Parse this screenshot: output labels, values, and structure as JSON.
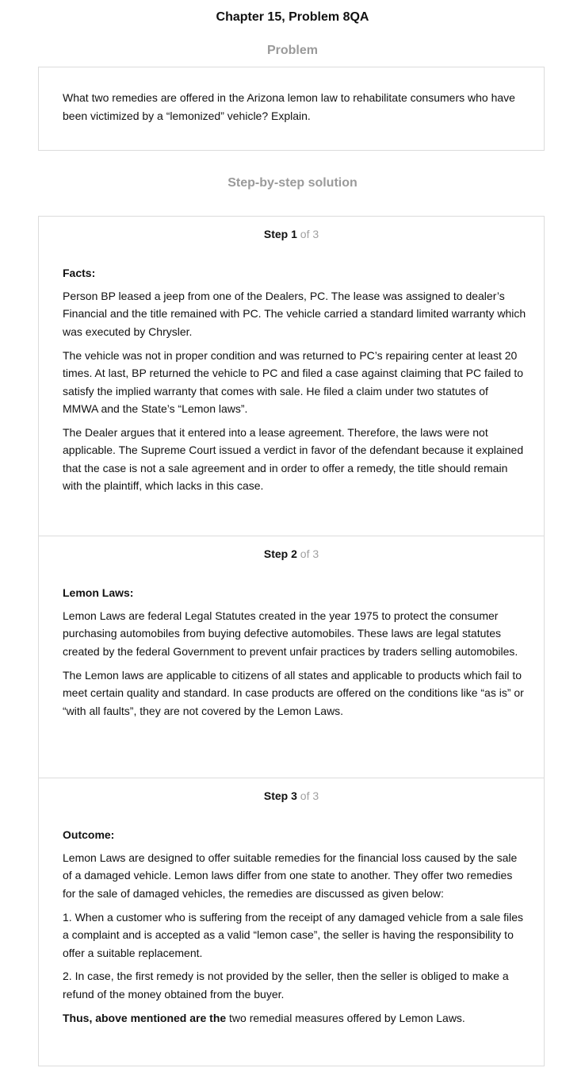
{
  "title": "Chapter 15, Problem 8QA",
  "problem": {
    "heading": "Problem",
    "text": "What two remedies are offered in the Arizona lemon law to rehabilitate consumers who have been victimized by a “lemonized” vehicle? Explain."
  },
  "solution": {
    "heading": "Step-by-step solution",
    "steps": [
      {
        "label": "Step",
        "number": "1",
        "of": "of 3",
        "heading": "Facts:",
        "paragraphs": [
          "Person BP leased a jeep from one of the Dealers, PC. The lease was assigned to dealer’s Financial and the title remained with PC. The vehicle carried a standard limited warranty which was executed by Chrysler.",
          "The vehicle was not in proper condition and was returned to PC’s repairing center at least 20 times. At last, BP returned the vehicle to PC and filed a case against claiming that PC failed to satisfy the implied warranty that comes with sale. He filed a claim under two statutes of MMWA and the State’s “Lemon laws”.",
          "The Dealer argues that it entered into a lease agreement. Therefore, the laws were not applicable. The Supreme Court issued a verdict in favor of the defendant because it explained that the case is not a sale agreement and in order to offer a remedy, the title should remain with the plaintiff, which lacks in this case."
        ]
      },
      {
        "label": "Step",
        "number": "2",
        "of": "of 3",
        "heading": "Lemon Laws:",
        "paragraphs": [
          "Lemon Laws are federal Legal Statutes created in the year 1975 to protect the consumer purchasing automobiles from buying defective automobiles. These laws are legal statutes created by the federal Government to prevent unfair practices by traders selling automobiles.",
          "The Lemon laws are applicable to citizens of all states and applicable to products which fail to meet certain quality and standard. In case products are offered on the conditions like “as is” or “with all faults”, they are not covered by the Lemon Laws."
        ]
      },
      {
        "label": "Step",
        "number": "3",
        "of": "of 3",
        "heading": "Outcome:",
        "paragraphs": [
          "Lemon Laws are designed to offer suitable remedies for the financial loss caused by the sale of a damaged vehicle. Lemon laws differ from one state to another. They offer two remedies for the sale of damaged vehicles, the remedies are discussed as given below:",
          "1. When a customer who is suffering from the receipt of any damaged vehicle from a sale files a complaint and is accepted as a valid “lemon case”, the seller is having the responsibility to offer a suitable replacement.",
          "2. In case, the first remedy is not provided by the seller, then the seller is obliged to make a refund of the money obtained from the buyer."
        ],
        "conclusion_bold": "Thus, above mentioned are the",
        "conclusion_rest": " two remedial measures offered by Lemon Laws."
      }
    ]
  }
}
